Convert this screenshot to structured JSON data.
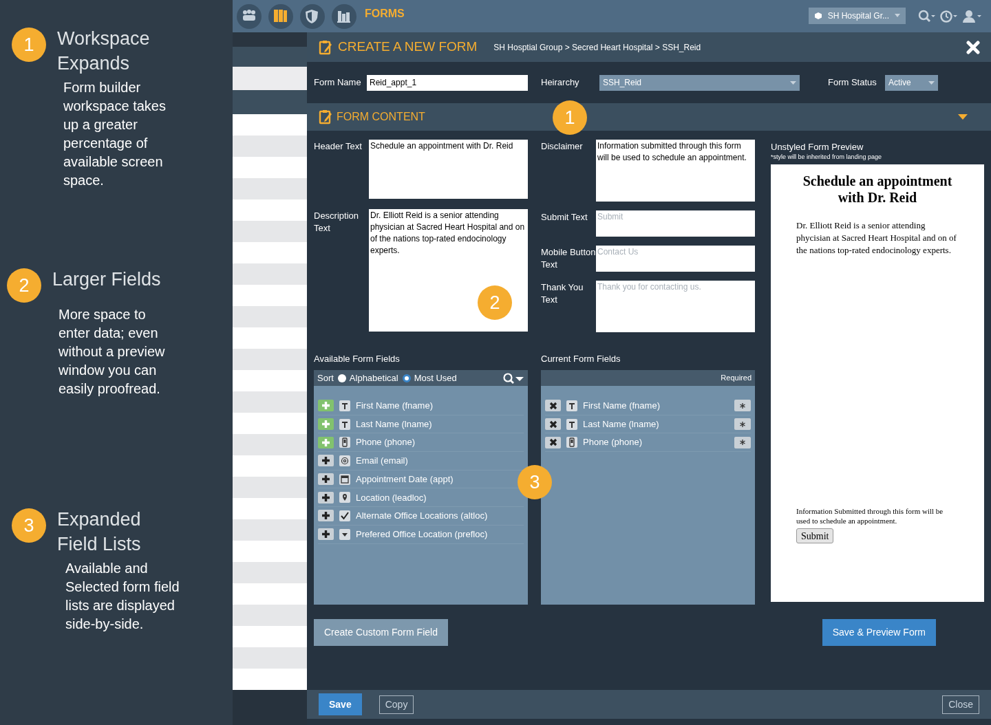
{
  "callouts": [
    {
      "number": "1",
      "title": "Workspace Expands",
      "body": "Form builder workspace takes up a greater percentage of available screen space."
    },
    {
      "number": "2",
      "title": "Larger Fields",
      "body": "More space to enter data; even without a preview window you can easily proofread."
    },
    {
      "number": "3",
      "title": "Expanded Field Lists",
      "body": "Available and Selected form field lists are displayed side-by-side."
    }
  ],
  "topbar": {
    "section_title": "FORMS",
    "org_dropdown": "SH Hospital Gr..."
  },
  "modal": {
    "title": "CREATE A NEW FORM",
    "breadcrumb": "SH Hosptial Group > Secred Heart Hospital > SSH_Reid",
    "form_name": {
      "label": "Form Name",
      "value": "Reid_appt_1"
    },
    "hierarchy": {
      "label": "Heirarchy",
      "value": "SSH_Reid"
    },
    "form_status": {
      "label": "Form Status",
      "value": "Active"
    },
    "content_title": "FORM CONTENT",
    "header_text": {
      "label": "Header Text",
      "value": "Schedule an appointment with Dr. Reid"
    },
    "description_text": {
      "label": "Description Text",
      "value": "Dr. Elliott Reid is a senior attending physician at Sacred Heart Hospital and on of the nations top-rated endocinology experts."
    },
    "disclaimer": {
      "label": "Disclaimer",
      "value": "Information submitted through this form will be used to schedule an appointment."
    },
    "submit_text": {
      "label": "Submit Text",
      "placeholder": "Submit"
    },
    "mobile_button_text": {
      "label": "Mobile Button Text",
      "placeholder": "Contact Us"
    },
    "thank_you_text": {
      "label": "Thank You Text",
      "placeholder": "Thank you for contacting us."
    },
    "available_fields": {
      "title": "Available Form Fields",
      "sort_label": "Sort",
      "sort_options": [
        {
          "label": "Alphabetical",
          "selected": false
        },
        {
          "label": "Most Used",
          "selected": true
        }
      ],
      "items": [
        {
          "label": "First Name (fname)",
          "kind": "text",
          "added": true
        },
        {
          "label": "Last Name (lname)",
          "kind": "text",
          "added": true
        },
        {
          "label": "Phone (phone)",
          "kind": "phone",
          "added": true
        },
        {
          "label": "Email (email)",
          "kind": "email",
          "added": false
        },
        {
          "label": "Appointment Date (appt)",
          "kind": "date",
          "added": false
        },
        {
          "label": "Location (leadloc)",
          "kind": "location",
          "added": false
        },
        {
          "label": "Alternate Office Locations (altloc)",
          "kind": "checkbox",
          "added": false
        },
        {
          "label": "Prefered Office Location (prefloc)",
          "kind": "dropdown",
          "added": false
        }
      ]
    },
    "current_fields": {
      "title": "Current Form Fields",
      "required_header": "Required",
      "items": [
        {
          "label": "First Name (fname)",
          "kind": "text",
          "required": true
        },
        {
          "label": "Last Name (lname)",
          "kind": "text",
          "required": true
        },
        {
          "label": "Phone (phone)",
          "kind": "phone",
          "required": true
        }
      ]
    },
    "preview": {
      "title": "Unstyled Form Preview",
      "note": "*style will be inherited from landing page",
      "heading": "Schedule an appointment with Dr. Reid",
      "description": "Dr. Elliott Reid is a senior attending phycisian at Sacred Heart Hospital and on of the nations top-rated endocinology experts.",
      "disclaimer": "Information Submitted through this form will be used to schedule an appointment.",
      "submit": "Submit"
    },
    "custom_field_button": "Create Custom Form Field",
    "save_preview_button": "Save & Preview Form",
    "footer_buttons": [
      {
        "label": "Save",
        "kind": "primary"
      },
      {
        "label": "Copy",
        "kind": "outline"
      },
      {
        "label": "Close",
        "kind": "outline"
      }
    ],
    "badges": [
      "1",
      "2",
      "3"
    ]
  }
}
